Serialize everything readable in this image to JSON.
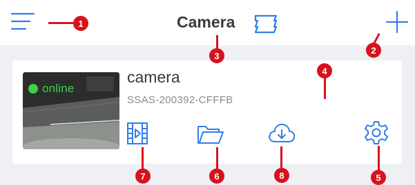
{
  "header": {
    "title": "Camera",
    "menu_icon": "menu-lines-icon",
    "switch_view_icon": "layout-switch-icon",
    "add_icon": "plus-icon"
  },
  "device": {
    "name": "camera",
    "id": "SSAS-200392-CFFFB",
    "status": "online"
  },
  "actions": {
    "playback_icon": "playback-film-icon",
    "files_icon": "folder-icon",
    "cloud_icon": "cloud-download-icon",
    "settings_icon": "gear-icon"
  },
  "callouts": [
    "1",
    "2",
    "3",
    "4",
    "5",
    "6",
    "7",
    "8"
  ],
  "colors": {
    "accent": "#2f7ee8",
    "marker": "#d8121c",
    "online": "#3fd044",
    "background": "#eef0f3",
    "card": "#ffffff"
  }
}
